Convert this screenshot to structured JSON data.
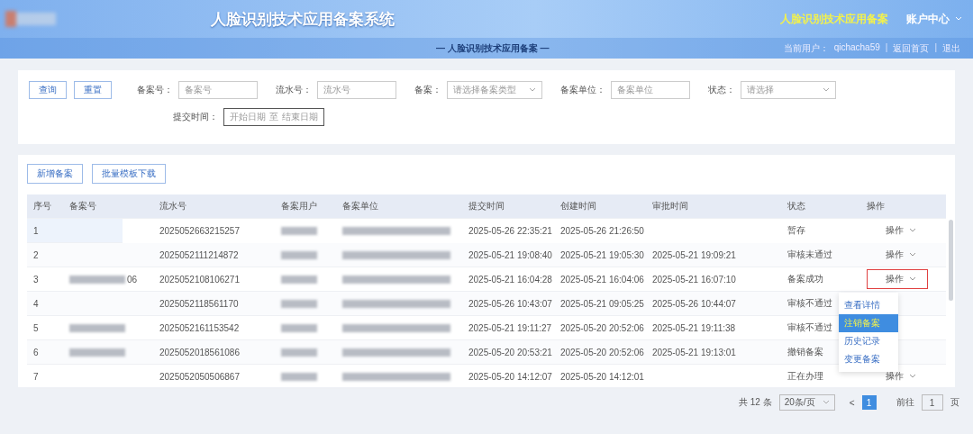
{
  "header": {
    "title": "人脸识别技术应用备案系统",
    "nav": [
      {
        "label": "人脸识别技术应用备案",
        "selected": true
      },
      {
        "label": "账户中心",
        "selected": false
      }
    ],
    "subtitle": "— 人脸识别技术应用备案 —",
    "user_label": "当前用户：",
    "user": "qichacha59",
    "separator": "|",
    "links": [
      "返回首页",
      "退出"
    ]
  },
  "filters": {
    "buttons": [
      "查询",
      "重置"
    ],
    "fields": [
      {
        "label": "备案号：",
        "placeholder": "备案号",
        "kind": "input"
      },
      {
        "label": "流水号：",
        "placeholder": "流水号",
        "kind": "input"
      },
      {
        "label": "备案：",
        "placeholder": "请选择备案类型",
        "kind": "select"
      },
      {
        "label": "备案单位：",
        "placeholder": "备案单位",
        "kind": "input"
      },
      {
        "label": "状态：",
        "placeholder": "请选择",
        "kind": "select"
      }
    ],
    "date": {
      "label": "提交时间：",
      "start": "开始日期",
      "sep": "至",
      "end": "结束日期"
    }
  },
  "toolbar": [
    "新增备案",
    "批量模板下载"
  ],
  "table": {
    "columns": [
      "序号",
      "备案号",
      "流水号",
      "备案用户",
      "备案单位",
      "提交时间",
      "创建时间",
      "审批时间",
      "状态",
      "操作"
    ],
    "rows": [
      {
        "index": "1",
        "record_tail": "",
        "record_redacted": false,
        "serial": "2025052663215257",
        "submitted": "2025-05-26 22:35:21",
        "created": "2025-05-26 21:26:50",
        "approved": "",
        "status": "暂存",
        "action": "操作",
        "selected": true,
        "highlighted": false
      },
      {
        "index": "2",
        "record_tail": "",
        "record_redacted": false,
        "serial": "2025052111214872",
        "submitted": "2025-05-21 19:08:40",
        "created": "2025-05-21 19:05:30",
        "approved": "2025-05-21 19:09:21",
        "status": "审核未通过",
        "action": "操作",
        "selected": false,
        "highlighted": false
      },
      {
        "index": "3",
        "record_tail": "06",
        "record_redacted": true,
        "serial": "2025052108106271",
        "submitted": "2025-05-21 16:04:28",
        "created": "2025-05-21 16:04:06",
        "approved": "2025-05-21 16:07:10",
        "status": "备案成功",
        "action": "操作",
        "selected": false,
        "highlighted": true
      },
      {
        "index": "4",
        "record_tail": "",
        "record_redacted": false,
        "serial": "2025052118561170",
        "submitted": "2025-05-26 10:43:07",
        "created": "2025-05-21 09:05:25",
        "approved": "2025-05-26 10:44:07",
        "status": "审核不通过",
        "selected": false
      },
      {
        "index": "5",
        "record_tail": "",
        "record_redacted": true,
        "serial": "2025052161153542",
        "submitted": "2025-05-21 19:11:27",
        "created": "2025-05-20 20:52:06",
        "approved": "2025-05-21 19:11:38",
        "status": "审核不通过",
        "selected": false
      },
      {
        "index": "6",
        "record_tail": "",
        "record_redacted": true,
        "serial": "2025052018561086",
        "submitted": "2025-05-20 20:53:21",
        "created": "2025-05-20 20:52:06",
        "approved": "2025-05-21 19:13:01",
        "status": "撤销备案",
        "selected": false
      },
      {
        "index": "7",
        "record_tail": "",
        "record_redacted": false,
        "serial": "2025052050506867",
        "submitted": "2025-05-20 14:12:07",
        "created": "2025-05-20 14:12:01",
        "approved": "",
        "status": "正在办理",
        "action": "操作",
        "selected": false,
        "highlighted": false
      }
    ]
  },
  "menu": {
    "open": true,
    "items": [
      {
        "label": "查看详情",
        "selected": false
      },
      {
        "label": "注销备案",
        "selected": true
      },
      {
        "label": "历史记录",
        "selected": false
      },
      {
        "label": "变更备案",
        "selected": false
      }
    ]
  },
  "pagination": {
    "total": "共 12 条",
    "page_size": "20条/页",
    "prev": "<",
    "pages": [
      {
        "label": "1",
        "selected": true
      }
    ],
    "goto": "前往",
    "goto_value": "1",
    "goto_unit": "页"
  }
}
